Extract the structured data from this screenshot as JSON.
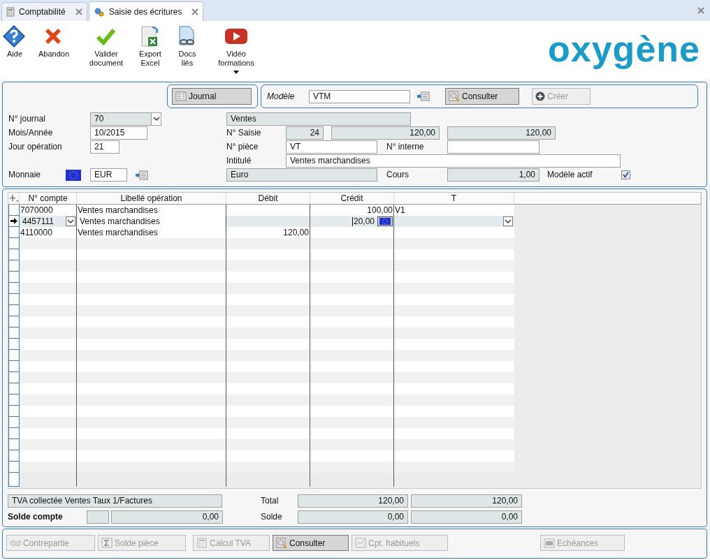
{
  "tabs": [
    {
      "label": "Comptabilité",
      "selected": false
    },
    {
      "label": "Saisie des écritures",
      "selected": true
    }
  ],
  "toolbar": [
    {
      "kind": "help",
      "label": "Aide"
    },
    {
      "kind": "cancel",
      "label": "Abandon"
    },
    {
      "kind": "validate",
      "label": "Valider\ndocument"
    },
    {
      "kind": "excel",
      "label": "Export\nExcel"
    },
    {
      "kind": "linked",
      "label": "Docs\nliés"
    },
    {
      "kind": "video",
      "label": "Vidéo\nformations",
      "dropdown": true
    }
  ],
  "logo": "oxygène",
  "journal_button": "Journal",
  "model": {
    "label": "Modèle",
    "value": "VTM",
    "consult_button": "Consulter",
    "create_button": {
      "label": "Créer",
      "disabled": true
    }
  },
  "form": {
    "journal": {
      "label": "N° journal",
      "value": "70",
      "name": "Ventes"
    },
    "month": {
      "label": "Mois/Année",
      "value": "10/2015"
    },
    "day": {
      "label": "Jour opération",
      "value": "21"
    },
    "currency": {
      "label": "Monnaie",
      "value": "EUR",
      "name": "Euro"
    },
    "entry": {
      "label": "N° Saisie",
      "value": "24",
      "total_debit": "120,00",
      "total_credit": "120,00"
    },
    "piece": {
      "label": "N° pièce",
      "value": "VT"
    },
    "internal": {
      "label": "N° interne"
    },
    "title": {
      "label": "Intitulé",
      "value": "Ventes marchandises"
    },
    "rate": {
      "label": "Cours",
      "value": "1,00"
    },
    "model_active": {
      "label": "Modèle actif",
      "checked": true
    }
  },
  "grid": {
    "columns": [
      "N° compte",
      "Libellé opération",
      "Débit",
      "Crédit",
      "T"
    ],
    "rows": [
      {
        "account": "7070000",
        "label": "Ventes marchandises",
        "credit": "100,00",
        "t": "V1",
        "current": false
      },
      {
        "account": "4457111",
        "label": "Ventes marchandises",
        "credit": "20,00",
        "current": true
      },
      {
        "account": "4110000",
        "label": "Ventes marchandises",
        "debit": "120,00",
        "current": false
      }
    ]
  },
  "footer": {
    "account_label": "TVA collectée Ventes Taux 1/Factures",
    "total_label": "Total",
    "total_debit": "120,00",
    "total_credit": "120,00",
    "balance_account_label": "Solde compte",
    "balance_account": "0,00",
    "balance_label": "Solde",
    "balance_debit": "0,00",
    "balance_credit": "0,00"
  },
  "actions": [
    {
      "kind": "counterpart",
      "label": "Contrepartie",
      "disabled": true
    },
    {
      "kind": "sum",
      "label": "Solde pièce",
      "disabled": true
    },
    {
      "kind": "calculator",
      "label": "Calcul TVA",
      "disabled": true
    },
    {
      "kind": "search",
      "label": "Consulter",
      "disabled": false
    },
    {
      "kind": "chart",
      "label": "Cpt. habituels",
      "disabled": true
    },
    {
      "kind": "calendar",
      "label": "Echéances",
      "disabled": true
    }
  ]
}
